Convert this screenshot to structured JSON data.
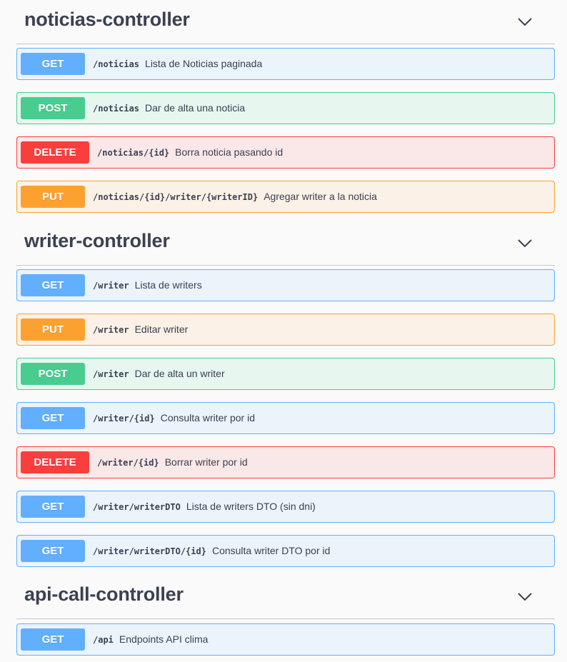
{
  "sections": [
    {
      "title": "noticias-controller",
      "operations": [
        {
          "method": "GET",
          "path": "/noticias",
          "summary": "Lista de Noticias paginada"
        },
        {
          "method": "POST",
          "path": "/noticias",
          "summary": "Dar de alta una noticia"
        },
        {
          "method": "DELETE",
          "path": "/noticias/{id}",
          "summary": "Borra noticia pasando id"
        },
        {
          "method": "PUT",
          "path": "/noticias/{id}/writer/{writerID}",
          "summary": "Agregar writer a la noticia"
        }
      ]
    },
    {
      "title": "writer-controller",
      "operations": [
        {
          "method": "GET",
          "path": "/writer",
          "summary": "Lista de writers"
        },
        {
          "method": "PUT",
          "path": "/writer",
          "summary": "Editar writer"
        },
        {
          "method": "POST",
          "path": "/writer",
          "summary": "Dar de alta un writer"
        },
        {
          "method": "GET",
          "path": "/writer/{id}",
          "summary": "Consulta writer por id"
        },
        {
          "method": "DELETE",
          "path": "/writer/{id}",
          "summary": "Borrar writer por id"
        },
        {
          "method": "GET",
          "path": "/writer/writerDTO",
          "summary": "Lista de writers DTO (sin dni)"
        },
        {
          "method": "GET",
          "path": "/writer/writerDTO/{id}",
          "summary": "Consulta writer DTO por id"
        }
      ]
    },
    {
      "title": "api-call-controller",
      "operations": [
        {
          "method": "GET",
          "path": "/api",
          "summary": "Endpoints API clima"
        }
      ]
    }
  ],
  "colors": {
    "get": "#61affe",
    "post": "#49cc90",
    "put": "#fca130",
    "delete": "#f93e3e"
  },
  "icons": {
    "collapse": "chevron-down-icon"
  }
}
